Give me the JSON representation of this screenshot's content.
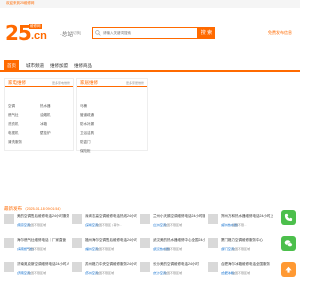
{
  "header": {
    "welcome": "欢迎来到25维修网",
    "logo": {
      "number": "25",
      "badge": "维修网",
      "suffix": ".cn"
    },
    "city": "·总站",
    "city_switch": "[切换]",
    "search": {
      "placeholder": "请输入关键词搜索",
      "button": "搜 索"
    },
    "publish": "免费发布信息"
  },
  "nav": {
    "items": [
      "首页",
      "城市频道",
      "维修加盟",
      "维修商品"
    ]
  },
  "panels": [
    {
      "title": "家电维修",
      "more": "更多家电维修",
      "items": [
        "空调",
        "热水器",
        "燃气灶",
        "油烟机",
        "洗衣机",
        "冰箱",
        "电视机",
        "壁挂炉",
        "清洗服务",
        ""
      ]
    },
    {
      "title": "家居维修",
      "more": "更多家居维修",
      "items": [
        "马桶",
        "管道疏通",
        "防水补漏",
        "卫浴洁具",
        "防盗门",
        "保险柜"
      ]
    }
  ],
  "latest": {
    "title": "最新发布",
    "date": "（2025-01-18 09:01:54）"
  },
  "cards": [
    {
      "title": "美的空调售后维修电话24小时服务中心",
      "tag": "[南京空调]",
      "desc": "全国不限区域"
    },
    {
      "title": "深圳志高空调维修电话热线24小时上门服务中心",
      "tag": "[深圳空调]",
      "desc": "全国不限区 | 荷尔..."
    },
    {
      "title": "兰州小天鹅空调维修电话24小时服务",
      "tag": "[兰州空调]",
      "desc": "全国不限区域"
    },
    {
      "title": "郑州万和热水器维修电话24小时上门 | 官方",
      "tag": "[郑州热水器]",
      "desc": "全国不限..."
    },
    {
      "title": "海尔燃气灶维修电话｜厂家直营",
      "tag": "[海南燃气灶]",
      "desc": "全国不限区域"
    },
    {
      "title": "福州海尔空调售后维修电话24小时上门",
      "tag": "[福州空调]",
      "desc": "全国不限区域"
    },
    {
      "title": "武汉美的热水器维修中心全国24小时",
      "tag": "[武汉热水器]",
      "desc": "全国不限区域"
    },
    {
      "title": "厦门格力空调维修服务中心",
      "tag": "[厦门空调]",
      "desc": "全国不限区域"
    },
    {
      "title": "济南奥克斯空调维修电话24小时人工服务",
      "tag": "[济南空调]",
      "desc": "全国不限区域"
    },
    {
      "title": "苏州格力中央空调维修服务24小时",
      "tag": "[苏州空调]",
      "desc": "全国不限区域"
    },
    {
      "title": "长沙美的空调维修电话24小时",
      "tag": "[长沙空调]",
      "desc": "全国不限区域"
    },
    {
      "title": "合肥海尔冰箱维修电话全国服务",
      "tag": "[合肥冰箱]",
      "desc": "全国不限区域"
    }
  ],
  "float": {
    "phone_label": "电话",
    "wechat_label": "微信",
    "top_label": "顶部"
  },
  "colors": {
    "accent": "#ff6a00",
    "green": "#4cbf4c"
  }
}
